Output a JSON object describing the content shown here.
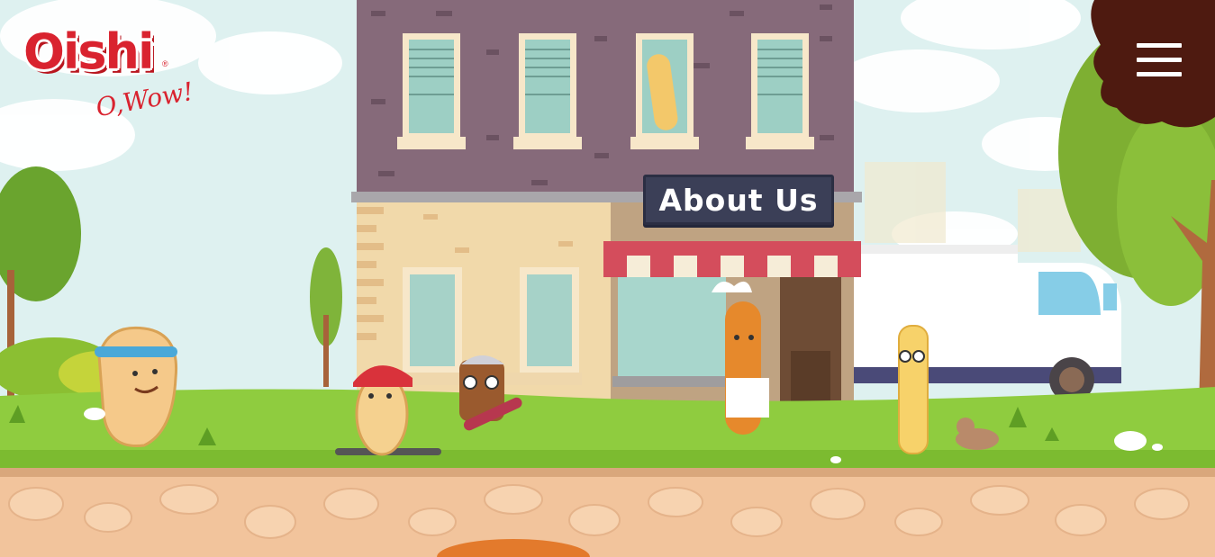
{
  "brand": {
    "name": "Oishi",
    "tagline": "O,Wow!",
    "registered": "®"
  },
  "sign": {
    "label": "About Us"
  },
  "menu": {
    "icon": "hamburger-menu-icon"
  },
  "colors": {
    "sky": "#dff1f1",
    "brand_red": "#d9232f",
    "building_top": "#866a7a",
    "grass": "#8fcc3f",
    "soil": "#f2c49c",
    "sign_bg": "#3b3f57",
    "menu_blob": "#4e1a10"
  }
}
